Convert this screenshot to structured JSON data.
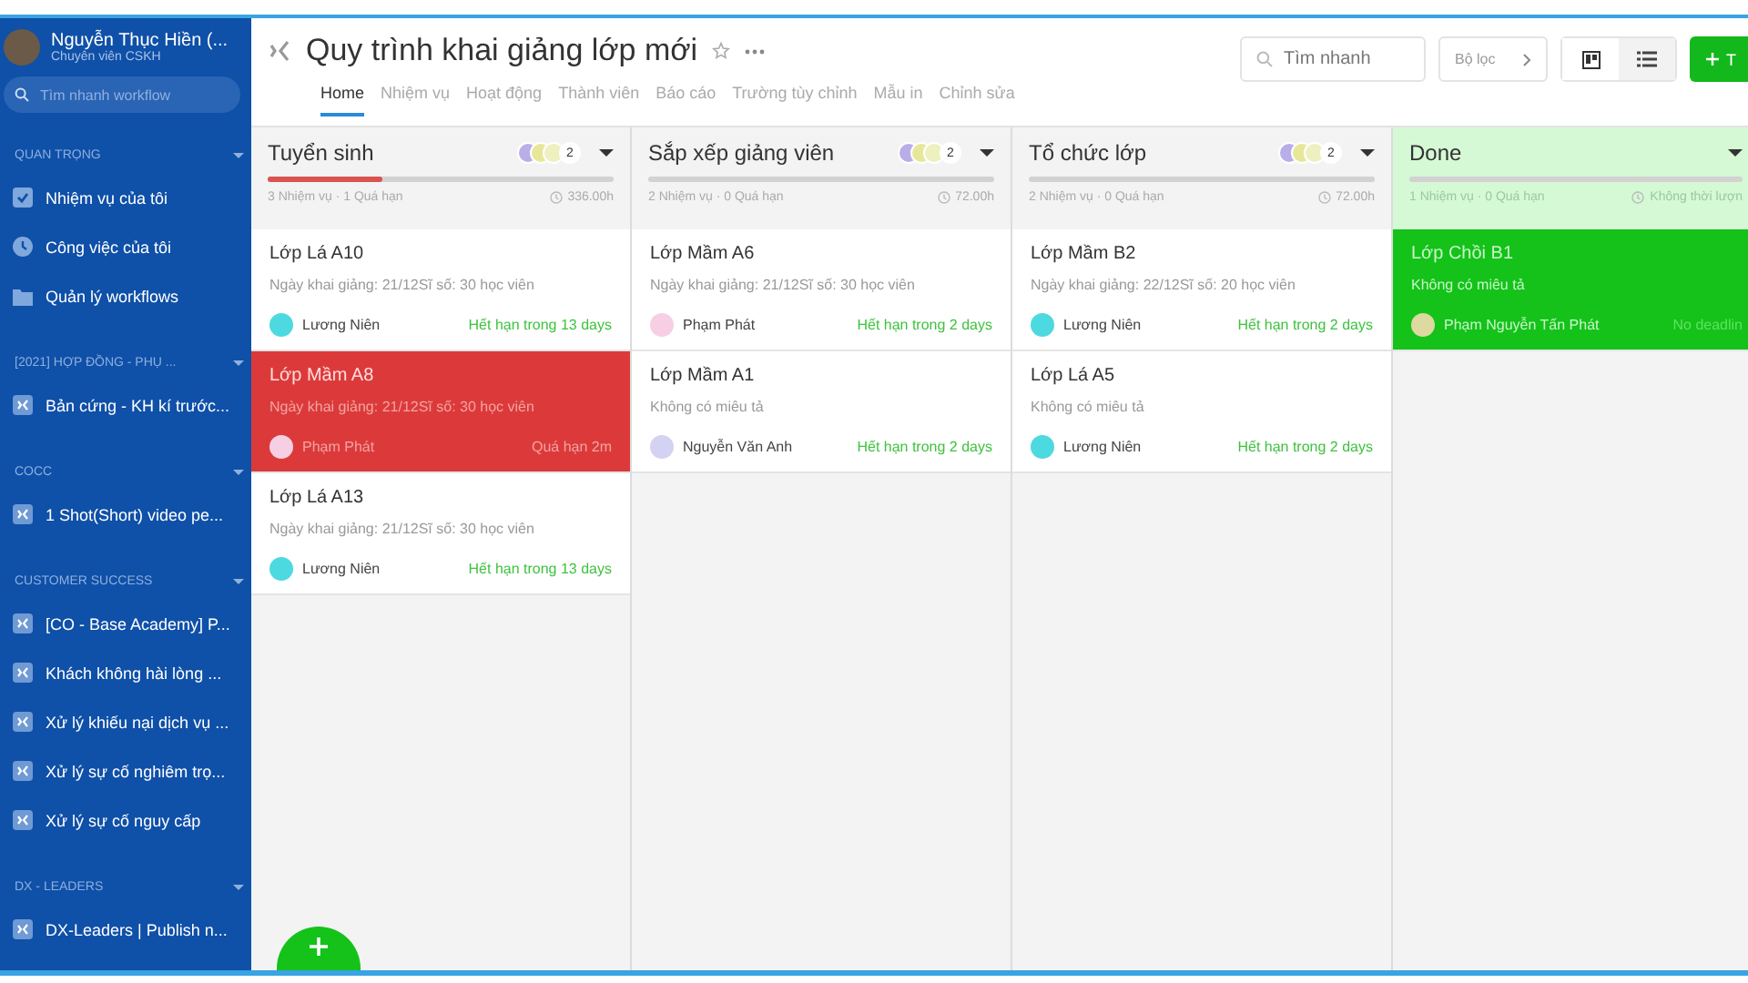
{
  "sidebar": {
    "user": {
      "name": "Nguyễn Thục Hiền (...",
      "role": "Chuyên viên CSKH"
    },
    "search": {
      "placeholder": "Tìm nhanh workflow"
    },
    "sections": [
      {
        "title": "QUAN TRỌNG",
        "items": [
          {
            "label": "Nhiệm vụ của tôi",
            "kind": "check"
          },
          {
            "label": "Công việc của tôi",
            "kind": "clock"
          },
          {
            "label": "Quản lý workflows",
            "kind": "folder"
          }
        ]
      },
      {
        "title": "[2021] HỢP ĐỒNG - PHỤ ...",
        "items": [
          {
            "label": "Bản cứng - KH kí trước...",
            "kind": "workflow"
          }
        ]
      },
      {
        "title": "COCC",
        "items": [
          {
            "label": "1 Shot(Short) video pe...",
            "kind": "workflow"
          }
        ]
      },
      {
        "title": "CUSTOMER SUCCESS",
        "items": [
          {
            "label": "[CO - Base Academy] P...",
            "kind": "workflow"
          },
          {
            "label": "Khách không hài lòng ...",
            "kind": "workflow"
          },
          {
            "label": "Xử lý khiếu nại dịch vụ ...",
            "kind": "workflow"
          },
          {
            "label": "Xử lý sự cố nghiêm trọ...",
            "kind": "workflow"
          },
          {
            "label": "Xử lý sự cố nguy cấp",
            "kind": "workflow"
          }
        ]
      },
      {
        "title": "DX - LEADERS",
        "items": [
          {
            "label": "DX-Leaders | Publish n...",
            "kind": "workflow"
          }
        ]
      }
    ]
  },
  "header": {
    "title": "Quy trình khai giảng lớp mới",
    "tabs": [
      {
        "label": "Home",
        "selected": true
      },
      {
        "label": "Nhiệm vụ",
        "selected": false
      },
      {
        "label": "Hoạt động",
        "selected": false
      },
      {
        "label": "Thành viên",
        "selected": false
      },
      {
        "label": "Báo cáo",
        "selected": false
      },
      {
        "label": "Trường tùy chỉnh",
        "selected": false
      },
      {
        "label": "Mẫu in",
        "selected": false
      },
      {
        "label": "Chỉnh sửa",
        "selected": false
      }
    ],
    "search": {
      "placeholder": "Tìm nhanh"
    },
    "filter": "Bộ lọc",
    "views": [
      {
        "kind": "board",
        "selected": true
      },
      {
        "kind": "list",
        "selected": false
      }
    ],
    "add_label": "T"
  },
  "columns": [
    {
      "title": "Tuyển sinh",
      "kind": "normal",
      "members": "2",
      "level": 0.33,
      "stats": "3 Nhiệm vụ · 1 Quá hạn",
      "duration": "336.00h",
      "cards": [
        {
          "title": "Lớp Lá A10",
          "kind": "normal",
          "desc": "Ngày khai giảng: 21/12Sĩ số: 30 học viên",
          "assignee": "Lương Niên",
          "color": "#4dd9e0",
          "due": "Hết hạn trong 13 days"
        },
        {
          "title": "Lớp Mầm A8",
          "kind": "overdue",
          "desc": "Ngày khai giảng: 21/12Sĩ số: 30 học viên",
          "assignee": "Phạm Phát",
          "color": "#f6cfe4",
          "due": "Quá hạn 2m"
        },
        {
          "title": "Lớp Lá A13",
          "kind": "normal",
          "desc": "Ngày khai giảng: 21/12Sĩ số: 30 học viên",
          "assignee": "Lương Niên",
          "color": "#4dd9e0",
          "due": "Hết hạn trong 13 days"
        }
      ]
    },
    {
      "title": "Sắp xếp giảng viên",
      "kind": "normal",
      "members": "2",
      "level": 0,
      "stats": "2 Nhiệm vụ · 0 Quá hạn",
      "duration": "72.00h",
      "cards": [
        {
          "title": "Lớp Mầm A6",
          "kind": "normal",
          "desc": "Ngày khai giảng: 21/12Sĩ số: 30 học viên",
          "assignee": "Phạm Phát",
          "color": "#f6cfe4",
          "due": "Hết hạn trong 2 days"
        },
        {
          "title": "Lớp Mầm A1",
          "kind": "normal",
          "desc": "Không có miêu tả",
          "assignee": "Nguyễn Văn Anh",
          "color": "#d4d2f3",
          "due": "Hết hạn trong 2 days"
        }
      ]
    },
    {
      "title": "Tổ chức lớp",
      "kind": "normal",
      "members": "2",
      "level": 0,
      "stats": "2 Nhiệm vụ · 0 Quá hạn",
      "duration": "72.00h",
      "cards": [
        {
          "title": "Lớp Mầm B2",
          "kind": "normal",
          "desc": "Ngày khai giảng: 22/12Sĩ số: 20 học viên",
          "assignee": "Lương Niên",
          "color": "#4dd9e0",
          "due": "Hết hạn trong 2 days"
        },
        {
          "title": "Lớp Lá A5",
          "kind": "normal",
          "desc": "Không có miêu tả",
          "assignee": "Lương Niên",
          "color": "#4dd9e0",
          "due": "Hết hạn trong 2 days"
        }
      ]
    },
    {
      "title": "Done",
      "kind": "done",
      "level": 0,
      "stats": "1 Nhiệm vụ · 0 Quá hạn",
      "duration": "Không thời lượn",
      "cards": [
        {
          "title": "Lớp Chồi B1",
          "kind": "done",
          "desc": "Không có miêu tả",
          "assignee": "Phạm Nguyễn Tấn Phát",
          "color": "#ddd9a0",
          "due": "No deadlin"
        }
      ]
    }
  ]
}
